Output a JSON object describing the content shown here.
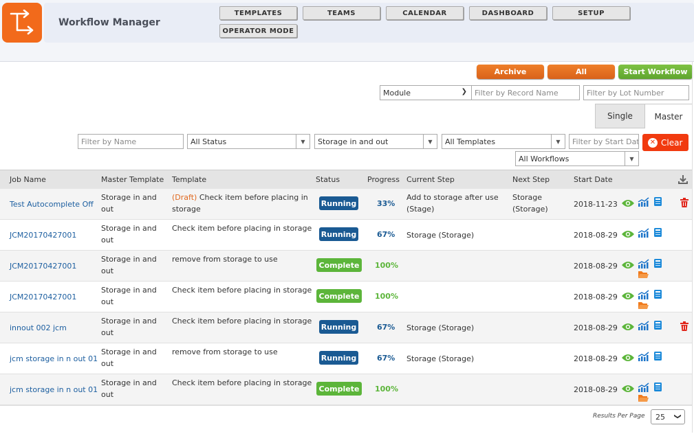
{
  "app": {
    "title": "Workflow Manager"
  },
  "nav": [
    {
      "label": "TEMPLATES"
    },
    {
      "label": "TEAMS"
    },
    {
      "label": "CALENDAR"
    },
    {
      "label": "DASHBOARD"
    },
    {
      "label": "SETUP"
    },
    {
      "label": "OPERATOR MODE"
    }
  ],
  "actions": {
    "archive": "Archive",
    "all": "All",
    "start": "Start Workflow"
  },
  "filters": {
    "module": "Module",
    "record_name_placeholder": "Filter by Record Name",
    "lot_number_placeholder": "Filter by Lot Number",
    "name_placeholder": "Filter by Name",
    "status": "All Status",
    "master_template": "Storage in and out",
    "templates": "All Templates",
    "start_date_placeholder": "Filter by Start Date",
    "workflows": "All Workflows",
    "clear": "Clear"
  },
  "tabs": {
    "single": "Single",
    "master": "Master"
  },
  "columns": {
    "job_name": "Job Name",
    "master_template": "Master Template",
    "template": "Template",
    "status": "Status",
    "progress": "Progress",
    "current_step": "Current Step",
    "next_step": "Next Step",
    "start_date": "Start Date"
  },
  "rows": [
    {
      "job": "Test Autocomplete Off",
      "master": "Storage in and out",
      "draft": "(Draft)",
      "template": "Check item before placing in storage",
      "status": "Running",
      "progress": "33%",
      "current": "Add to storage after use (Stage)",
      "next": "Storage (Storage)",
      "date": "2018-11-23"
    },
    {
      "job": "JCM20170427001",
      "master": "Storage in and out",
      "draft": "",
      "template": "Check item before placing in storage",
      "status": "Running",
      "progress": "67%",
      "current": "Storage (Storage)",
      "next": "",
      "date": "2018-08-29"
    },
    {
      "job": "JCM20170427001",
      "master": "Storage in and out",
      "draft": "",
      "template": "remove from storage to use",
      "status": "Complete",
      "progress": "100%",
      "current": "",
      "next": "",
      "date": "2018-08-29"
    },
    {
      "job": "JCM20170427001",
      "master": "Storage in and out",
      "draft": "",
      "template": "Check item before placing in storage",
      "status": "Complete",
      "progress": "100%",
      "current": "",
      "next": "",
      "date": "2018-08-29"
    },
    {
      "job": "innout 002 jcm",
      "master": "Storage in and out",
      "draft": "",
      "template": "Check item before placing in storage",
      "status": "Running",
      "progress": "67%",
      "current": "Storage (Storage)",
      "next": "",
      "date": "2018-08-29"
    },
    {
      "job": "jcm storage in n out 01",
      "master": "Storage in and out",
      "draft": "",
      "template": "remove from storage to use",
      "status": "Running",
      "progress": "67%",
      "current": "Storage (Storage)",
      "next": "",
      "date": "2018-08-29"
    },
    {
      "job": "jcm storage in n out 01",
      "master": "Storage in and out",
      "draft": "",
      "template": "Check item before placing in storage",
      "status": "Complete",
      "progress": "100%",
      "current": "",
      "next": "",
      "date": "2018-08-29"
    }
  ],
  "footer": {
    "results_per_page_label": "Results Per Page",
    "results_per_page": "25"
  },
  "colors": {
    "accent": "#f26a1b",
    "running": "#1a5a93",
    "complete": "#5cb53a",
    "clear": "#f13a0f"
  }
}
